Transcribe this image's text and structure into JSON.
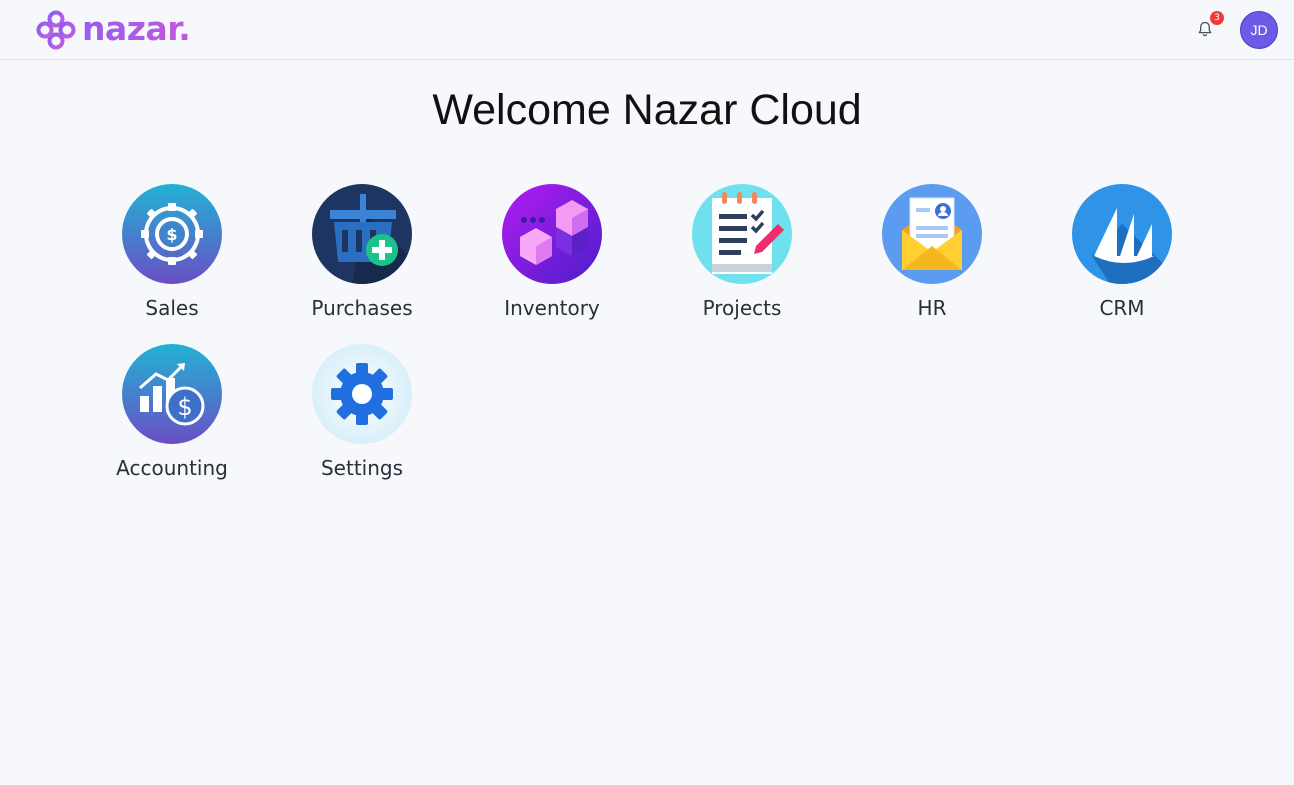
{
  "brand": {
    "name": "nazar."
  },
  "header": {
    "notification_count": "3",
    "user_initials": "JD"
  },
  "page": {
    "welcome_title": "Welcome Nazar Cloud"
  },
  "apps": [
    {
      "label": "Sales",
      "icon": "sales-icon"
    },
    {
      "label": "Purchases",
      "icon": "purchases-icon"
    },
    {
      "label": "Inventory",
      "icon": "inventory-icon"
    },
    {
      "label": "Projects",
      "icon": "projects-icon"
    },
    {
      "label": "HR",
      "icon": "hr-icon"
    },
    {
      "label": "CRM",
      "icon": "crm-icon"
    },
    {
      "label": "Accounting",
      "icon": "accounting-icon"
    },
    {
      "label": "Settings",
      "icon": "settings-icon"
    }
  ],
  "colors": {
    "brand": "#a35cf0",
    "badge": "#ef3b3b",
    "avatar": "#6b5be6",
    "background": "#f6f8fb"
  }
}
